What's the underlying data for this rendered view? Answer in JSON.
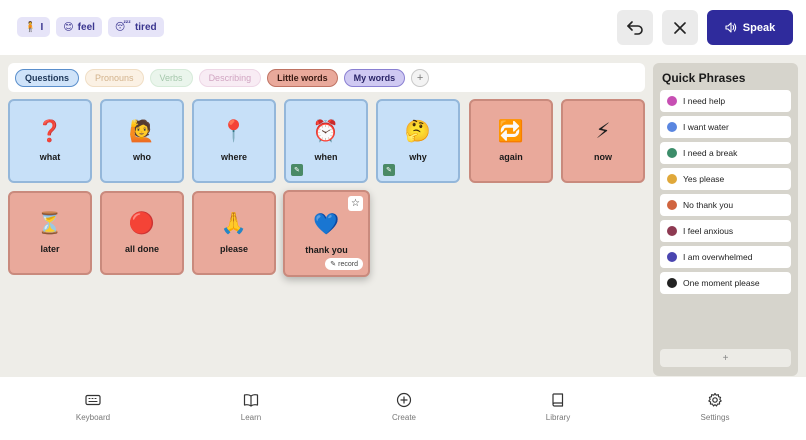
{
  "sentence": [
    {
      "emoji": "🧍",
      "word": "I"
    },
    {
      "emoji": "😊",
      "word": "feel"
    },
    {
      "emoji": "😴",
      "word": "tired"
    }
  ],
  "header": {
    "undo_icon": "undo-icon",
    "clear_icon": "close-icon",
    "speak_label": "Speak",
    "speak_color": "#2f2b9c"
  },
  "tabs": [
    {
      "label": "Questions",
      "state": "active"
    },
    {
      "label": "Pronouns",
      "state": "disabled"
    },
    {
      "label": "Verbs",
      "state": "disabled"
    },
    {
      "label": "Describing",
      "state": "disabled"
    },
    {
      "label": "Little words",
      "state": "normal"
    },
    {
      "label": "My words",
      "state": "normal"
    }
  ],
  "tiles": [
    {
      "emoji": "❓",
      "label": "what"
    },
    {
      "emoji": "🙋",
      "label": "who"
    },
    {
      "emoji": "📍",
      "label": "where"
    },
    {
      "emoji": "⏰",
      "label": "when"
    },
    {
      "emoji": "🤔",
      "label": "why"
    },
    {
      "emoji": "🔁",
      "label": "again"
    },
    {
      "emoji": "⚡",
      "label": "now"
    },
    {
      "emoji": "⏳",
      "label": "later"
    },
    {
      "emoji": "🔴",
      "label": "all done"
    },
    {
      "emoji": "🙏",
      "label": "please"
    },
    {
      "emoji": "💙",
      "label": "thank you",
      "badge": "record"
    }
  ],
  "quick_phrases": {
    "title": "Quick Phrases",
    "items": [
      {
        "label": "I need help",
        "color": "#c74fb3"
      },
      {
        "label": "I want water",
        "color": "#5a86e0"
      },
      {
        "label": "I need a break",
        "color": "#3c8d6a"
      },
      {
        "label": "Yes please",
        "color": "#e0a83a"
      },
      {
        "label": "No thank you",
        "color": "#d0643f"
      },
      {
        "label": "I feel anxious",
        "color": "#8e3a52"
      },
      {
        "label": "I am overwhelmed",
        "color": "#4a45b0"
      },
      {
        "label": "One moment please",
        "color": "#222222"
      }
    ],
    "add_label": "+"
  },
  "nav": [
    {
      "label": "Keyboard",
      "icon": "keyboard-icon"
    },
    {
      "label": "Learn",
      "icon": "book-open-icon"
    },
    {
      "label": "Create",
      "icon": "plus-circle-icon"
    },
    {
      "label": "Library",
      "icon": "book-icon"
    },
    {
      "label": "Settings",
      "icon": "gear-icon"
    }
  ]
}
